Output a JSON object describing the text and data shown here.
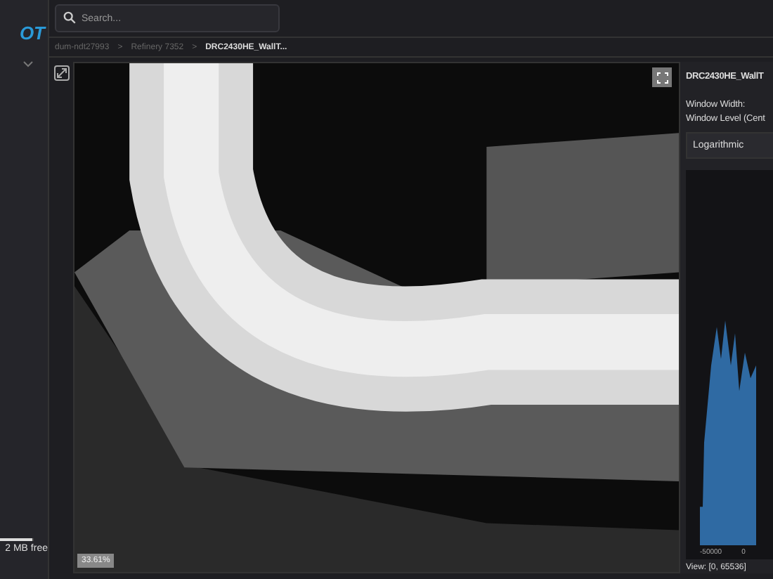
{
  "sidebar": {
    "logo": "OT",
    "storage": {
      "label": "2 MB free",
      "level": 0.95
    }
  },
  "search": {
    "placeholder": "Search..."
  },
  "breadcrumbs": [
    {
      "label": "dum-ndt27993",
      "selected": false
    },
    {
      "label": "Refinery 7352",
      "selected": false
    },
    {
      "label": "DRC2430HE_WallT...",
      "selected": true
    }
  ],
  "breadcrumb_separator": ">",
  "viewer": {
    "zoom": "33.61%"
  },
  "panel": {
    "title": "DRC2430HE_WallT",
    "window_width": "Window Width:",
    "window_level": "Window Level (Cent",
    "scale": "Logarithmic",
    "histogram": {
      "x_ticks": [
        "-50000",
        "0"
      ],
      "view": "View: [0, 65536]"
    }
  }
}
